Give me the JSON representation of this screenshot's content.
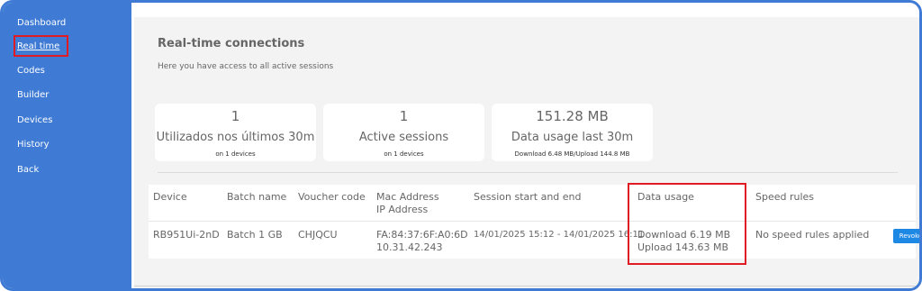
{
  "sidebar": {
    "items": [
      {
        "label": "Dashboard"
      },
      {
        "label": "Real time",
        "active": true
      },
      {
        "label": "Codes"
      },
      {
        "label": "Builder"
      },
      {
        "label": "Devices"
      },
      {
        "label": "History"
      },
      {
        "label": "Back"
      }
    ]
  },
  "header": {
    "title": "Real-time connections",
    "subtitle": "Here you have access to all active sessions"
  },
  "cards": [
    {
      "value": "1",
      "label": "Utilizados nos últimos 30m",
      "sub": "on 1 devices"
    },
    {
      "value": "1",
      "label": "Active sessions",
      "sub": "on 1 devices"
    },
    {
      "value": "151.28 MB",
      "label": "Data usage last 30m",
      "sub": "Download 6.48 MB/Upload 144.8 MB"
    }
  ],
  "table": {
    "columns": {
      "device": "Device",
      "batch": "Batch name",
      "voucher": "Voucher code",
      "mac_line1": "Mac Address",
      "mac_line2": "IP Address",
      "session": "Session start and end",
      "data": "Data usage",
      "speed": "Speed rules"
    },
    "rows": [
      {
        "device": "RB951Ui-2nD",
        "batch": "Batch 1 GB",
        "voucher": "CHJQCU",
        "mac": "FA:84:37:6F:A0:6D",
        "ip": "10.31.42.243",
        "session": "14/01/2025 15:12 - 14/01/2025 16:11",
        "download": "Download 6.19 MB",
        "upload": "Upload 143.63 MB",
        "speed": "No speed rules applied",
        "action": "Revoke"
      }
    ]
  },
  "colors": {
    "sidebar": "#3f7bd4",
    "highlight": "#e01b24",
    "button": "#1e88e5"
  }
}
